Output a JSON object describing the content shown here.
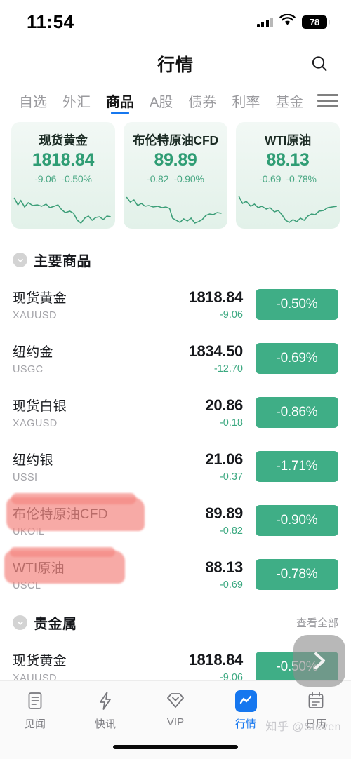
{
  "status_bar": {
    "time": "11:54",
    "battery_level": "78",
    "signal_icon": "cellular-signal-icon",
    "wifi_icon": "wifi-icon",
    "battery_icon": "battery-icon"
  },
  "header": {
    "title": "行情",
    "search_icon": "search-icon"
  },
  "tabs": {
    "items": [
      {
        "label": "自选",
        "active": false
      },
      {
        "label": "外汇",
        "active": false
      },
      {
        "label": "商品",
        "active": true
      },
      {
        "label": "A股",
        "active": false
      },
      {
        "label": "债券",
        "active": false
      },
      {
        "label": "利率",
        "active": false
      },
      {
        "label": "基金",
        "active": false
      }
    ],
    "menu_icon": "hamburger-menu-icon",
    "active_underline_color": "#1677ef"
  },
  "cards": [
    {
      "name": "现货黄金",
      "price": "1818.84",
      "change": "-9.06",
      "percent": "-0.50%"
    },
    {
      "name": "布伦特原油CFD",
      "price": "89.89",
      "change": "-0.82",
      "percent": "-0.90%"
    },
    {
      "name": "WTI原油",
      "price": "88.13",
      "change": "-0.69",
      "percent": "-0.78%"
    }
  ],
  "sections": [
    {
      "title": "主要商品",
      "chevron_icon": "chevron-down-circle-icon",
      "more_label": "",
      "rows": [
        {
          "name": "现货黄金",
          "code": "XAUUSD",
          "price": "1818.84",
          "delta": "-9.06",
          "percent": "-0.50%",
          "highlighted": false
        },
        {
          "name": "纽约金",
          "code": "USGC",
          "price": "1834.50",
          "delta": "-12.70",
          "percent": "-0.69%",
          "highlighted": false
        },
        {
          "name": "现货白银",
          "code": "XAGUSD",
          "price": "20.86",
          "delta": "-0.18",
          "percent": "-0.86%",
          "highlighted": false
        },
        {
          "name": "纽约银",
          "code": "USSI",
          "price": "21.06",
          "delta": "-0.37",
          "percent": "-1.71%",
          "highlighted": false
        },
        {
          "name": "布伦特原油CFD",
          "code": "UKOIL",
          "price": "89.89",
          "delta": "-0.82",
          "percent": "-0.90%",
          "highlighted": true
        },
        {
          "name": "WTI原油",
          "code": "USCL",
          "price": "88.13",
          "delta": "-0.69",
          "percent": "-0.78%",
          "highlighted": true
        }
      ]
    },
    {
      "title": "贵金属",
      "chevron_icon": "chevron-down-circle-icon",
      "more_label": "查看全部",
      "rows": [
        {
          "name": "现货黄金",
          "code": "XAUUSD",
          "price": "1818.84",
          "delta": "-9.06",
          "percent": "-0.50%",
          "highlighted": false
        }
      ]
    }
  ],
  "float_nav": {
    "icon": "chevron-right-icon"
  },
  "bottom_nav": {
    "items": [
      {
        "label": "见闻",
        "icon": "document-icon",
        "active": false
      },
      {
        "label": "快讯",
        "icon": "lightning-bolt-icon",
        "active": false
      },
      {
        "label": "VIP",
        "icon": "diamond-icon",
        "active": false
      },
      {
        "label": "行情",
        "icon": "line-chart-icon",
        "active": true
      },
      {
        "label": "日历",
        "icon": "calendar-icon",
        "active": false
      }
    ]
  },
  "watermark": "知乎 @Steven",
  "colors": {
    "accent_blue": "#1677ef",
    "down_green": "#3fae86",
    "card_green_text": "#2f9d74",
    "highlight_pink": "#f58a84"
  }
}
